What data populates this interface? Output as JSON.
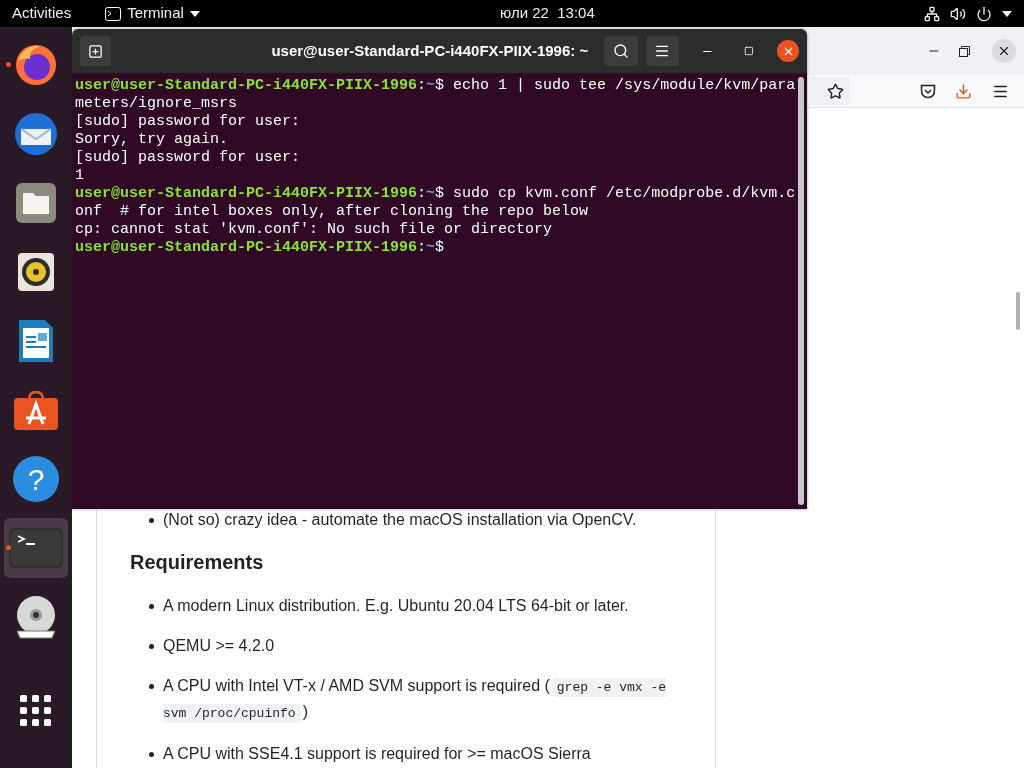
{
  "top_bar": {
    "activities": "Activities",
    "app_menu": "Terminal",
    "clock": "юли 22  13:04"
  },
  "dock": [
    {
      "kind": "firefox",
      "running": true,
      "selected": false
    },
    {
      "kind": "mail",
      "running": false,
      "selected": false
    },
    {
      "kind": "files",
      "running": false,
      "selected": false
    },
    {
      "kind": "music",
      "running": false,
      "selected": false
    },
    {
      "kind": "writer",
      "running": false,
      "selected": false
    },
    {
      "kind": "store",
      "running": false,
      "selected": false
    },
    {
      "kind": "help",
      "running": false,
      "selected": false,
      "glyph": "?"
    },
    {
      "kind": "terminal",
      "running": true,
      "selected": true
    },
    {
      "kind": "dvd",
      "running": false,
      "selected": false
    },
    {
      "kind": "apps",
      "running": false,
      "selected": false
    }
  ],
  "browser": {
    "article": {
      "partial_item": "(Not so) crazy idea - automate the macOS installation via OpenCV.",
      "heading": "Requirements",
      "items": [
        [
          {
            "kind": "text",
            "text": "A modern Linux distribution. E.g. Ubuntu 20.04 LTS 64-bit or later."
          }
        ],
        [
          {
            "kind": "text",
            "text": "QEMU >= 4.2.0"
          }
        ],
        [
          {
            "kind": "text",
            "text": "A CPU with Intel VT-x / AMD SVM support is required ("
          },
          {
            "kind": "code",
            "text": "grep -e vmx -e svm /proc/cpuinfo"
          },
          {
            "kind": "text",
            "text": ")"
          }
        ],
        [
          {
            "kind": "text",
            "text": "A CPU with SSE4.1 support is required for >= macOS Sierra"
          }
        ]
      ]
    }
  },
  "terminal": {
    "title": "user@user-Standard-PC-i440FX-PIIX-1996: ~",
    "lines": [
      {
        "kind": "prompt",
        "host": "user@user-Standard-PC-i440FX-PIIX-1996",
        "sep": ":",
        "path": "~",
        "command": "$ echo 1 | sudo tee /sys/module/kvm/parameters/ignore_msrs"
      },
      {
        "kind": "output",
        "text": "[sudo] password for user:"
      },
      {
        "kind": "output",
        "text": "Sorry, try again."
      },
      {
        "kind": "output",
        "text": "[sudo] password for user:"
      },
      {
        "kind": "output",
        "text": "1"
      },
      {
        "kind": "prompt",
        "host": "user@user-Standard-PC-i440FX-PIIX-1996",
        "sep": ":",
        "path": "~",
        "command": "$ sudo cp kvm.conf /etc/modprobe.d/kvm.conf  # for intel boxes only, after cloning the repo below"
      },
      {
        "kind": "output",
        "text": "cp: cannot stat 'kvm.conf': No such file or directory"
      },
      {
        "kind": "prompt",
        "host": "user@user-Standard-PC-i440FX-PIIX-1996",
        "sep": ":",
        "path": "~",
        "command": "$"
      }
    ]
  }
}
